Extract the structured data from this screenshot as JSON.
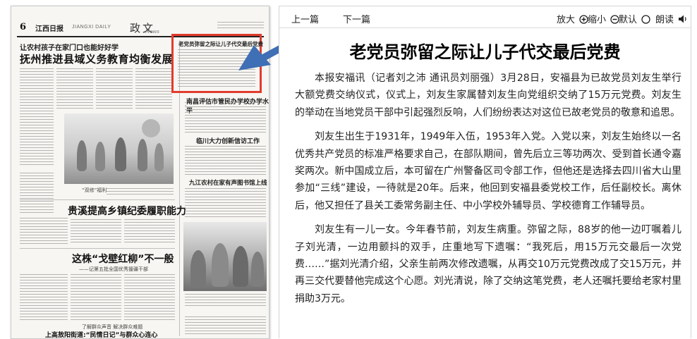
{
  "newspaper": {
    "page_number": "6",
    "masthead": "江西日报",
    "masthead_en": "JIANGXI DAILY",
    "section": "政文",
    "section_en": "News",
    "kicker": "让农村孩子在家门口也能好好学",
    "headline": "抚州推进县域义务教育均衡发展",
    "boxed_story_title": "老党员弥留之际让儿子代交最后党费",
    "story_headlines": [
      "南昌评估市管民办学校办学水平",
      "临川大力创新信访工作",
      "九江农村在家有声图书馆上线",
      "贵溪提高乡镇纪委履职能力",
      "这株“戈壁红柳”不一般",
      "上高敖阳街道:“民情日记”与群众心连心"
    ],
    "story_subheads": [
      "——记第五批全国优秀援疆干部",
      "了解群众声音  解决群众难题"
    ],
    "photo_caption": "“双修”福利"
  },
  "reader": {
    "toolbar": {
      "prev_label": "上一篇",
      "next_label": "下一篇",
      "zoom_in_label": "放大",
      "zoom_out_label": "缩小",
      "default_label": "默认",
      "read_aloud_label": "朗读"
    },
    "article": {
      "title": "老党员弥留之际让儿子代交最后党费",
      "paragraphs": [
        "本报安福讯（记者刘之沛 通讯员刘丽强）3月28日，安福县为已故党员刘友生举行大额党费交纳仪式，仪式上，刘友生家属替刘友生向党组织交纳了15万元党费。刘友生的举动在当地党员干部中引起强烈反响，人们纷纷表达对这位已故老党员的敬意和追思。",
        "刘友生出生于1931年，1949年入伍，1953年入党。入党以来，刘友生始终以一名优秀共产党员的标准严格要求自己，在部队期间，曾先后立三等功两次、受到首长通令嘉奖两次。新中国成立后，本可留在广州警备区司令部工作，但他还是选择去四川省大山里参加“三线”建设，一待就是20年。后来，他回到安福县委党校工作，后任副校长。离休后，他又担任了县关工委常务副主任、中小学校外辅导员、学校德育工作辅导员。",
        "刘友生有一儿一女。今年春节前，刘友生病重。弥留之际，88岁的他一边叮嘱着儿子刘光清，一边用颤抖的双手，庄重地写下遗嘱：“我死后，用15万元交最后一次党费……”据刘光清介绍，父亲生前两次修改遗嘱，从再交10万元党费改成了交15万元，并再三交代要替他完成这个心愿。刘光清说，除了交纳这笔党费，老人还嘱托要给老家村里捐助3万元。"
      ]
    }
  },
  "colors": {
    "highlight_box": "#e33b2f",
    "pointer_arrow": "#3f6fb4"
  }
}
